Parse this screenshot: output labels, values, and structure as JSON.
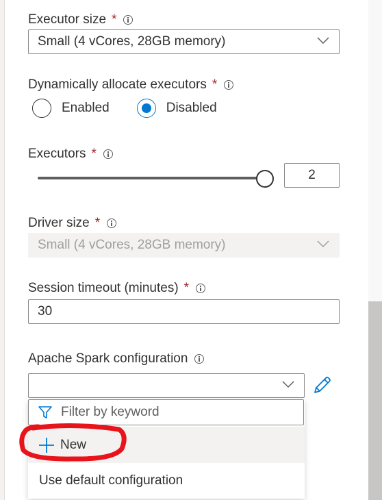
{
  "executor_size": {
    "label": "Executor size",
    "required": "*",
    "value": "Small (4 vCores, 28GB memory)"
  },
  "dynamic_allocation": {
    "label": "Dynamically allocate executors",
    "required": "*",
    "options": [
      {
        "label": "Enabled",
        "checked": false
      },
      {
        "label": "Disabled",
        "checked": true
      }
    ]
  },
  "executors": {
    "label": "Executors",
    "required": "*",
    "value": "2",
    "slider_fraction": 1.0
  },
  "driver_size": {
    "label": "Driver size",
    "required": "*",
    "value": "Small (4 vCores, 28GB memory)",
    "disabled": true
  },
  "session_timeout": {
    "label": "Session timeout (minutes)",
    "required": "*",
    "value": "30"
  },
  "spark_config": {
    "label": "Apache Spark configuration",
    "value": "",
    "filter_placeholder": "Filter by keyword",
    "menu_items": [
      "New",
      "Use default configuration"
    ]
  },
  "colors": {
    "accent": "#0078d4",
    "annotation": "#e8141b",
    "required": "#a4262c"
  },
  "icons": [
    "info-icon",
    "chevron-down-icon",
    "pencil-icon",
    "filter-icon",
    "plus-icon"
  ]
}
